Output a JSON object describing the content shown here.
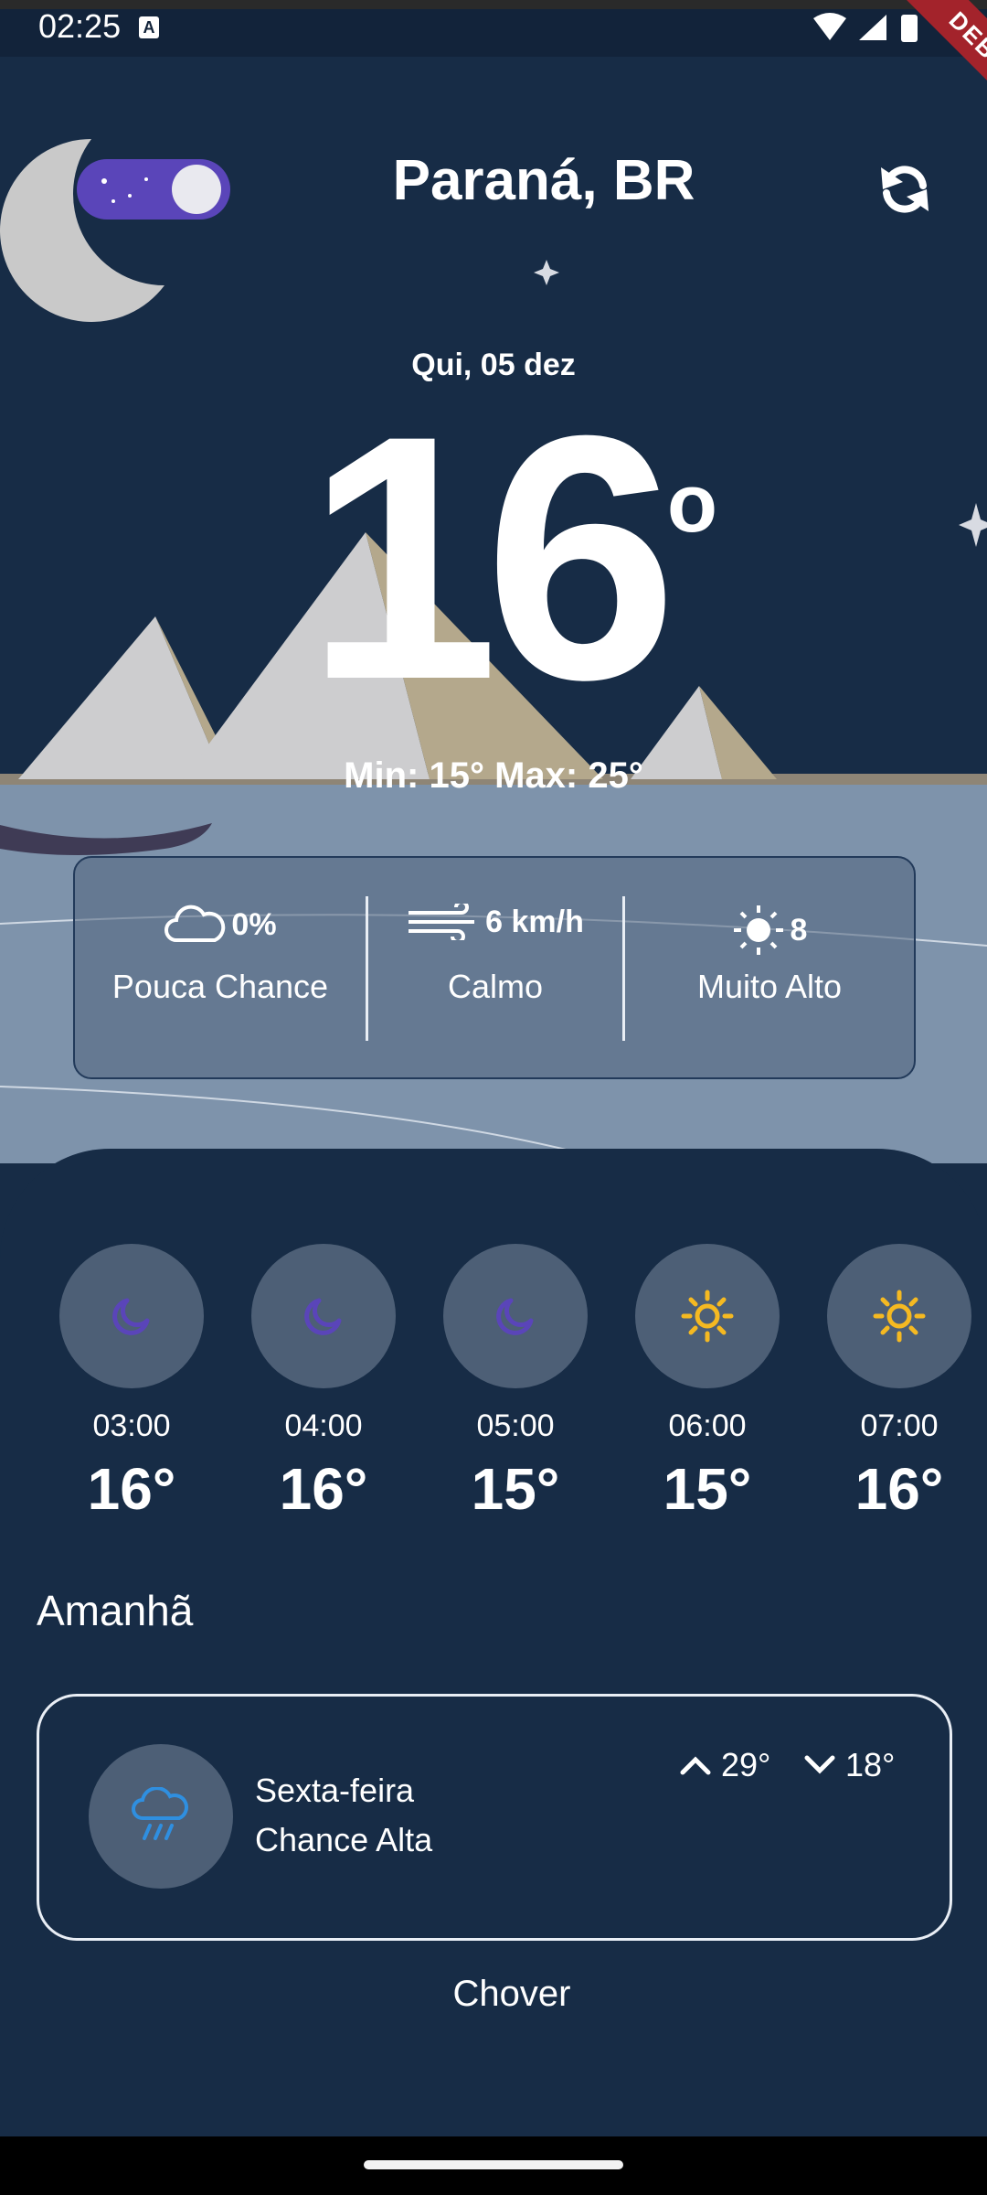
{
  "status_bar": {
    "time": "02:25",
    "notification_letter": "A"
  },
  "debug_badge": "DEBUG",
  "header": {
    "location": "Paraná, BR"
  },
  "today": {
    "date": "Qui, 05 dez",
    "temperature": "16",
    "degree_symbol": "o",
    "min_max": "Min: 15° Max: 25°"
  },
  "details": {
    "rain": {
      "value": "0%",
      "label": "Pouca Chance",
      "icon": "cloud-icon"
    },
    "wind": {
      "value": "6 km/h",
      "label": "Calmo",
      "icon": "wind-icon"
    },
    "uv": {
      "value": "8",
      "label": "Muito Alto",
      "icon": "sun-icon"
    }
  },
  "hourly": [
    {
      "time": "03:00",
      "temp": "16°",
      "icon": "moon-icon"
    },
    {
      "time": "04:00",
      "temp": "16°",
      "icon": "moon-icon"
    },
    {
      "time": "05:00",
      "temp": "15°",
      "icon": "moon-icon"
    },
    {
      "time": "06:00",
      "temp": "15°",
      "icon": "sun-icon"
    },
    {
      "time": "07:00",
      "temp": "16°",
      "icon": "sun-icon"
    }
  ],
  "tomorrow": {
    "title": "Amanhã",
    "day": "Sexta-feira",
    "chance": "Chance Alta",
    "max": "29°",
    "min": "18°",
    "condition": "Chover",
    "icon": "rain-cloud-icon"
  },
  "colors": {
    "background": "#172c46",
    "water": "#7e93ab",
    "toggle": "#5a45b9",
    "moon_icon": "#5a45b9",
    "sun_icon": "#f5b921",
    "rain_icon": "#2f8fe0"
  }
}
